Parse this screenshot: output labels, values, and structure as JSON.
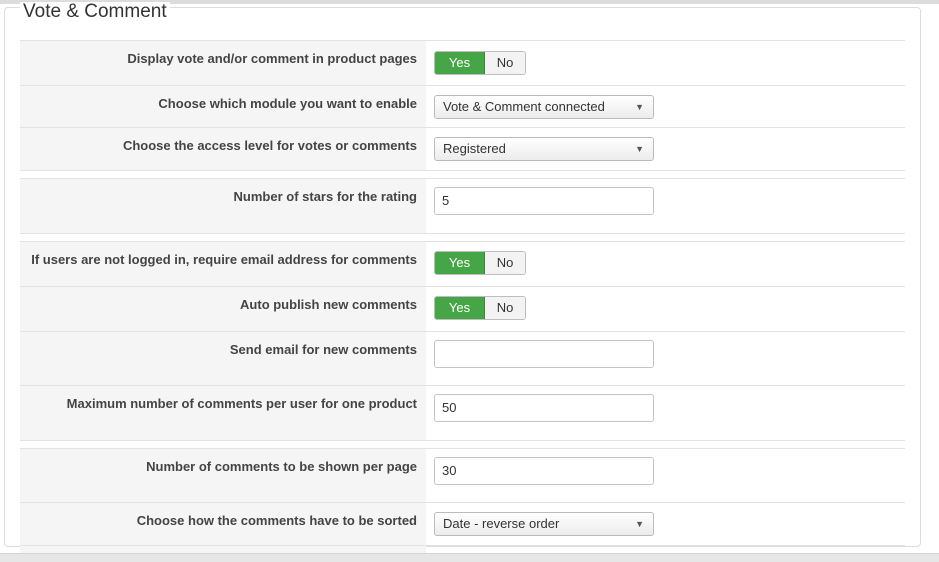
{
  "fieldset": {
    "legend": "Vote & Comment"
  },
  "rows": [
    {
      "label": "Display vote and/or comment in product pages",
      "type": "toggle",
      "yes": "Yes",
      "no": "No",
      "value": "Yes"
    },
    {
      "label": "Choose which module you want to enable",
      "type": "select",
      "value": "Vote & Comment connected"
    },
    {
      "label": "Choose the access level for votes or comments",
      "type": "select",
      "value": "Registered"
    },
    {
      "label": "Number of stars for the rating",
      "type": "input",
      "value": "5"
    },
    {
      "label": "If users are not logged in, require email address for comments",
      "type": "toggle",
      "yes": "Yes",
      "no": "No",
      "value": "Yes"
    },
    {
      "label": "Auto publish new comments",
      "type": "toggle",
      "yes": "Yes",
      "no": "No",
      "value": "Yes"
    },
    {
      "label": "Send email for new comments",
      "type": "input",
      "value": ""
    },
    {
      "label": "Maximum number of comments per user for one product",
      "type": "input",
      "value": "50"
    },
    {
      "label": "Number of comments to be shown per page",
      "type": "input",
      "value": "30"
    },
    {
      "label": "Choose how the comments have to be sorted",
      "type": "select",
      "value": "Date - reverse order"
    }
  ],
  "colors": {
    "toggle_active": "#46a546",
    "label_bg": "#f5f5f5"
  },
  "icons": {
    "select_arrow": "caret-down-icon"
  }
}
